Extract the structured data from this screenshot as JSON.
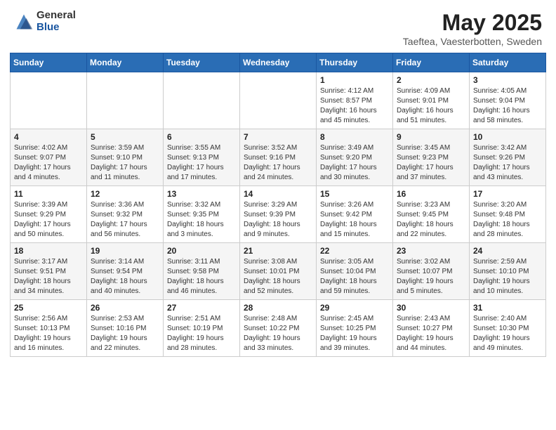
{
  "header": {
    "logo_general": "General",
    "logo_blue": "Blue",
    "month_year": "May 2025",
    "location": "Taeftea, Vaesterbotten, Sweden"
  },
  "days_of_week": [
    "Sunday",
    "Monday",
    "Tuesday",
    "Wednesday",
    "Thursday",
    "Friday",
    "Saturday"
  ],
  "weeks": [
    [
      {
        "day": "",
        "sunrise": "",
        "sunset": "",
        "daylight": ""
      },
      {
        "day": "",
        "sunrise": "",
        "sunset": "",
        "daylight": ""
      },
      {
        "day": "",
        "sunrise": "",
        "sunset": "",
        "daylight": ""
      },
      {
        "day": "",
        "sunrise": "",
        "sunset": "",
        "daylight": ""
      },
      {
        "day": "1",
        "sunrise": "Sunrise: 4:12 AM",
        "sunset": "Sunset: 8:57 PM",
        "daylight": "Daylight: 16 hours and 45 minutes."
      },
      {
        "day": "2",
        "sunrise": "Sunrise: 4:09 AM",
        "sunset": "Sunset: 9:01 PM",
        "daylight": "Daylight: 16 hours and 51 minutes."
      },
      {
        "day": "3",
        "sunrise": "Sunrise: 4:05 AM",
        "sunset": "Sunset: 9:04 PM",
        "daylight": "Daylight: 16 hours and 58 minutes."
      }
    ],
    [
      {
        "day": "4",
        "sunrise": "Sunrise: 4:02 AM",
        "sunset": "Sunset: 9:07 PM",
        "daylight": "Daylight: 17 hours and 4 minutes."
      },
      {
        "day": "5",
        "sunrise": "Sunrise: 3:59 AM",
        "sunset": "Sunset: 9:10 PM",
        "daylight": "Daylight: 17 hours and 11 minutes."
      },
      {
        "day": "6",
        "sunrise": "Sunrise: 3:55 AM",
        "sunset": "Sunset: 9:13 PM",
        "daylight": "Daylight: 17 hours and 17 minutes."
      },
      {
        "day": "7",
        "sunrise": "Sunrise: 3:52 AM",
        "sunset": "Sunset: 9:16 PM",
        "daylight": "Daylight: 17 hours and 24 minutes."
      },
      {
        "day": "8",
        "sunrise": "Sunrise: 3:49 AM",
        "sunset": "Sunset: 9:20 PM",
        "daylight": "Daylight: 17 hours and 30 minutes."
      },
      {
        "day": "9",
        "sunrise": "Sunrise: 3:45 AM",
        "sunset": "Sunset: 9:23 PM",
        "daylight": "Daylight: 17 hours and 37 minutes."
      },
      {
        "day": "10",
        "sunrise": "Sunrise: 3:42 AM",
        "sunset": "Sunset: 9:26 PM",
        "daylight": "Daylight: 17 hours and 43 minutes."
      }
    ],
    [
      {
        "day": "11",
        "sunrise": "Sunrise: 3:39 AM",
        "sunset": "Sunset: 9:29 PM",
        "daylight": "Daylight: 17 hours and 50 minutes."
      },
      {
        "day": "12",
        "sunrise": "Sunrise: 3:36 AM",
        "sunset": "Sunset: 9:32 PM",
        "daylight": "Daylight: 17 hours and 56 minutes."
      },
      {
        "day": "13",
        "sunrise": "Sunrise: 3:32 AM",
        "sunset": "Sunset: 9:35 PM",
        "daylight": "Daylight: 18 hours and 3 minutes."
      },
      {
        "day": "14",
        "sunrise": "Sunrise: 3:29 AM",
        "sunset": "Sunset: 9:39 PM",
        "daylight": "Daylight: 18 hours and 9 minutes."
      },
      {
        "day": "15",
        "sunrise": "Sunrise: 3:26 AM",
        "sunset": "Sunset: 9:42 PM",
        "daylight": "Daylight: 18 hours and 15 minutes."
      },
      {
        "day": "16",
        "sunrise": "Sunrise: 3:23 AM",
        "sunset": "Sunset: 9:45 PM",
        "daylight": "Daylight: 18 hours and 22 minutes."
      },
      {
        "day": "17",
        "sunrise": "Sunrise: 3:20 AM",
        "sunset": "Sunset: 9:48 PM",
        "daylight": "Daylight: 18 hours and 28 minutes."
      }
    ],
    [
      {
        "day": "18",
        "sunrise": "Sunrise: 3:17 AM",
        "sunset": "Sunset: 9:51 PM",
        "daylight": "Daylight: 18 hours and 34 minutes."
      },
      {
        "day": "19",
        "sunrise": "Sunrise: 3:14 AM",
        "sunset": "Sunset: 9:54 PM",
        "daylight": "Daylight: 18 hours and 40 minutes."
      },
      {
        "day": "20",
        "sunrise": "Sunrise: 3:11 AM",
        "sunset": "Sunset: 9:58 PM",
        "daylight": "Daylight: 18 hours and 46 minutes."
      },
      {
        "day": "21",
        "sunrise": "Sunrise: 3:08 AM",
        "sunset": "Sunset: 10:01 PM",
        "daylight": "Daylight: 18 hours and 52 minutes."
      },
      {
        "day": "22",
        "sunrise": "Sunrise: 3:05 AM",
        "sunset": "Sunset: 10:04 PM",
        "daylight": "Daylight: 18 hours and 59 minutes."
      },
      {
        "day": "23",
        "sunrise": "Sunrise: 3:02 AM",
        "sunset": "Sunset: 10:07 PM",
        "daylight": "Daylight: 19 hours and 5 minutes."
      },
      {
        "day": "24",
        "sunrise": "Sunrise: 2:59 AM",
        "sunset": "Sunset: 10:10 PM",
        "daylight": "Daylight: 19 hours and 10 minutes."
      }
    ],
    [
      {
        "day": "25",
        "sunrise": "Sunrise: 2:56 AM",
        "sunset": "Sunset: 10:13 PM",
        "daylight": "Daylight: 19 hours and 16 minutes."
      },
      {
        "day": "26",
        "sunrise": "Sunrise: 2:53 AM",
        "sunset": "Sunset: 10:16 PM",
        "daylight": "Daylight: 19 hours and 22 minutes."
      },
      {
        "day": "27",
        "sunrise": "Sunrise: 2:51 AM",
        "sunset": "Sunset: 10:19 PM",
        "daylight": "Daylight: 19 hours and 28 minutes."
      },
      {
        "day": "28",
        "sunrise": "Sunrise: 2:48 AM",
        "sunset": "Sunset: 10:22 PM",
        "daylight": "Daylight: 19 hours and 33 minutes."
      },
      {
        "day": "29",
        "sunrise": "Sunrise: 2:45 AM",
        "sunset": "Sunset: 10:25 PM",
        "daylight": "Daylight: 19 hours and 39 minutes."
      },
      {
        "day": "30",
        "sunrise": "Sunrise: 2:43 AM",
        "sunset": "Sunset: 10:27 PM",
        "daylight": "Daylight: 19 hours and 44 minutes."
      },
      {
        "day": "31",
        "sunrise": "Sunrise: 2:40 AM",
        "sunset": "Sunset: 10:30 PM",
        "daylight": "Daylight: 19 hours and 49 minutes."
      }
    ]
  ]
}
